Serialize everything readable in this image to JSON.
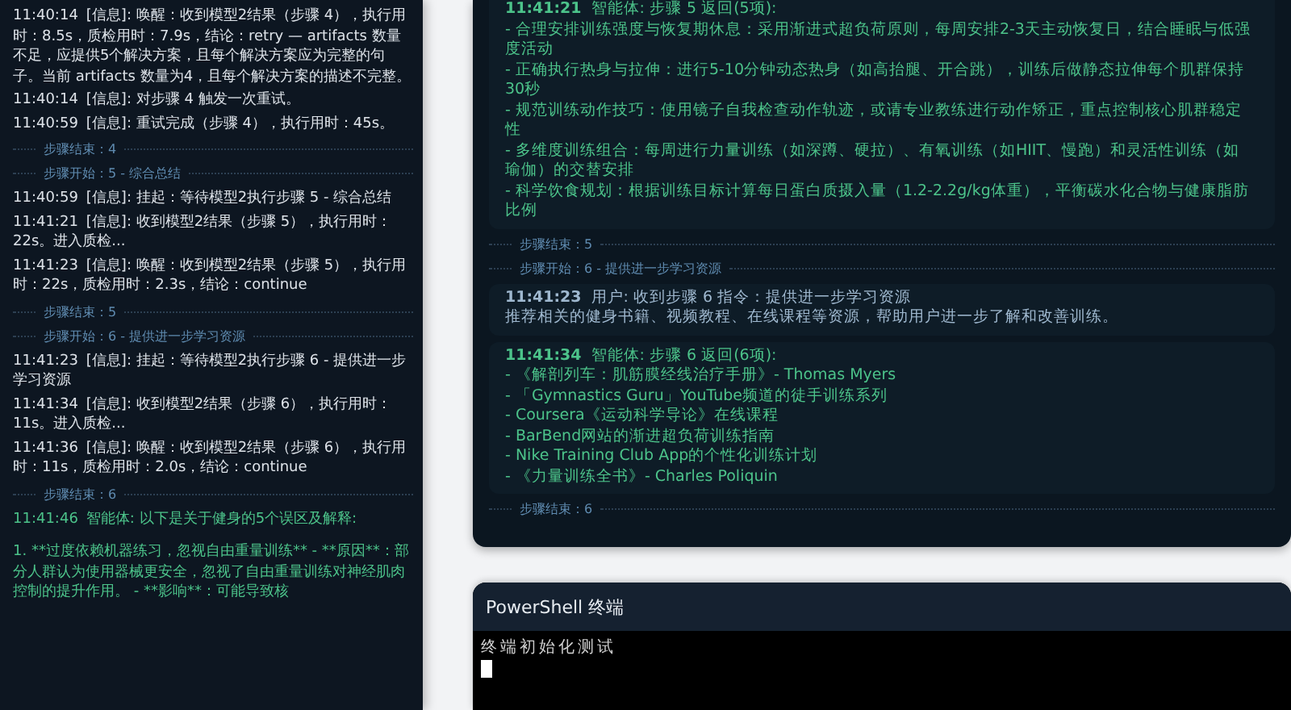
{
  "log_panel": {
    "entries": [
      {
        "kind": "log",
        "time": "11:40:14",
        "text": "[信息]: 唤醒：收到模型2结果（步骤 4），执行用时：8.5s，质检用时：7.9s，结论：retry — artifacts 数量不足，应提供5个解决方案，且每个解决方案应为完整的句子。当前 artifacts 数量为4，且每个解决方案的描述不完整。"
      },
      {
        "kind": "log",
        "time": "11:40:14",
        "text": "[信息]: 对步骤 4 触发一次重试。"
      },
      {
        "kind": "log",
        "time": "11:40:59",
        "text": "[信息]: 重试完成（步骤 4），执行用时：45s。"
      },
      {
        "kind": "marker",
        "text": "步骤结束：4"
      },
      {
        "kind": "marker",
        "text": "步骤开始：5 - 综合总结"
      },
      {
        "kind": "log",
        "time": "11:40:59",
        "text": "[信息]: 挂起：等待模型2执行步骤 5 - 综合总结"
      },
      {
        "kind": "log",
        "time": "11:41:21",
        "text": "[信息]: 收到模型2结果（步骤 5），执行用时：22s。进入质检..."
      },
      {
        "kind": "log",
        "time": "11:41:23",
        "text": "[信息]: 唤醒：收到模型2结果（步骤 5），执行用时：22s，质检用时：2.3s，结论：continue"
      },
      {
        "kind": "marker",
        "text": "步骤结束：5"
      },
      {
        "kind": "marker",
        "text": "步骤开始：6 - 提供进一步学习资源"
      },
      {
        "kind": "log",
        "time": "11:41:23",
        "text": "[信息]: 挂起：等待模型2执行步骤 6 - 提供进一步学习资源"
      },
      {
        "kind": "log",
        "time": "11:41:34",
        "text": "[信息]: 收到模型2结果（步骤 6），执行用时：11s。进入质检..."
      },
      {
        "kind": "log",
        "time": "11:41:36",
        "text": "[信息]: 唤醒：收到模型2结果（步骤 6），执行用时：11s，质检用时：2.0s，结论：continue"
      },
      {
        "kind": "marker",
        "text": "步骤结束：6"
      },
      {
        "kind": "agent",
        "time": "11:41:46",
        "text": "智能体: 以下是关于健身的5个误区及解释:",
        "body": "1. **过度依赖机器练习，忽视自由重量训练** - **原因**：部分人群认为使用器械更安全，忽视了自由重量训练对神经肌肉控制的提升作用。 - **影响**：可能导致核"
      }
    ]
  },
  "conversation": {
    "entries": [
      {
        "kind": "agent",
        "time": "11:41:21",
        "title": "智能体: 步骤 5 返回(5项):",
        "lines": [
          "- 合理安排训练强度与恢复期休息：采用渐进式超负荷原则，每周安排2-3天主动恢复日，结合睡眠与低强度活动",
          "- 正确执行热身与拉伸：进行5-10分钟动态热身（如高抬腿、开合跳），训练后做静态拉伸每个肌群保持30秒",
          "- 规范训练动作技巧：使用镜子自我检查动作轨迹，或请专业教练进行动作矫正，重点控制核心肌群稳定性",
          "- 多维度训练组合：每周进行力量训练（如深蹲、硬拉）、有氧训练（如HIIT、慢跑）和灵活性训练（如瑜伽）的交替安排",
          "- 科学饮食规划：根据训练目标计算每日蛋白质摄入量（1.2-2.2g/kg体重），平衡碳水化合物与健康脂肪比例"
        ]
      },
      {
        "kind": "marker",
        "text": "步骤结束：5"
      },
      {
        "kind": "marker",
        "text": "步骤开始：6 - 提供进一步学习资源"
      },
      {
        "kind": "user",
        "time": "11:41:23",
        "title": "用户: 收到步骤 6 指令：提供进一步学习资源",
        "lines": [
          "推荐相关的健身书籍、视频教程、在线课程等资源，帮助用户进一步了解和改善训练。"
        ]
      },
      {
        "kind": "agent",
        "time": "11:41:34",
        "title": "智能体: 步骤 6 返回(6项):",
        "lines": [
          "- 《解剖列车：肌筋膜经线治疗手册》- Thomas Myers",
          "- 「Gymnastics Guru」YouTube频道的徒手训练系列",
          "- Coursera《运动科学导论》在线课程",
          "- BarBend网站的渐进超负荷训练指南",
          "- Nike Training Club App的个性化训练计划",
          "- 《力量训练全书》- Charles Poliquin"
        ]
      },
      {
        "kind": "marker",
        "text": "步骤结束：6"
      }
    ]
  },
  "terminal": {
    "title": "PowerShell 终端",
    "output": "终端初始化测试",
    "cursor": true
  }
}
